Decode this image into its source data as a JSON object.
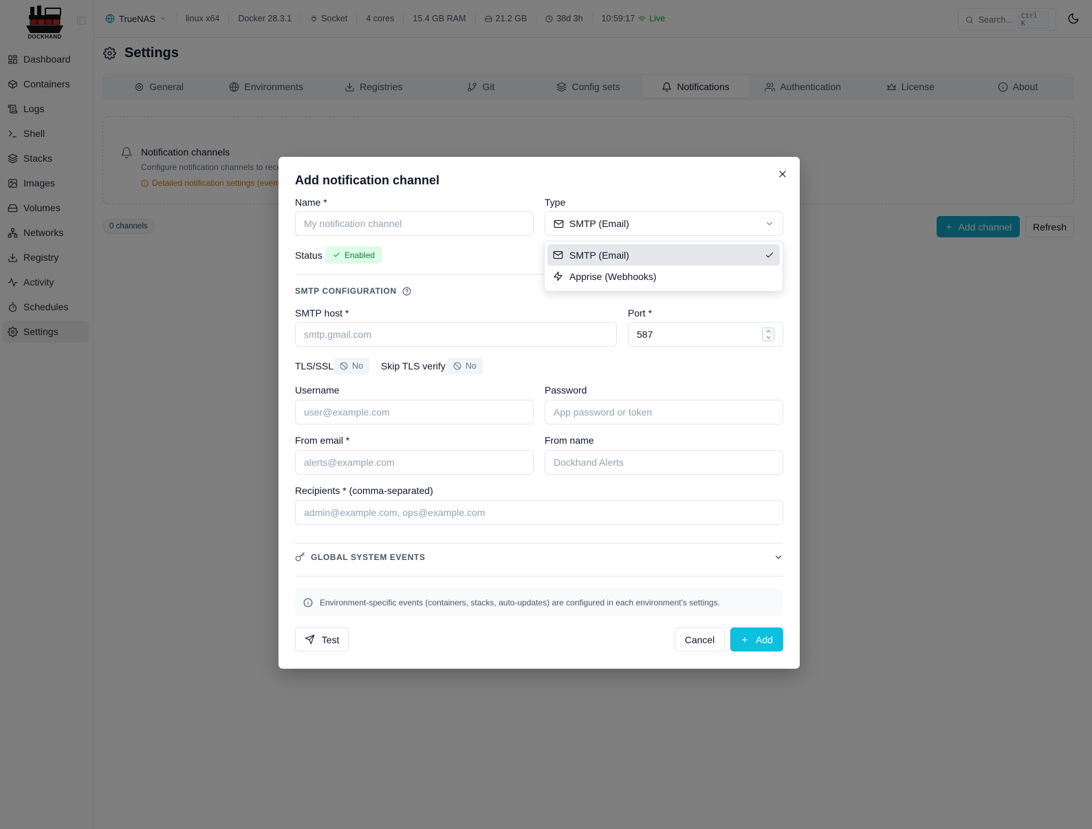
{
  "app": {
    "logo_text": "DOCKHAND"
  },
  "sidebar": {
    "items": [
      {
        "label": "Dashboard",
        "icon": "dashboard-icon"
      },
      {
        "label": "Containers",
        "icon": "box-icon"
      },
      {
        "label": "Logs",
        "icon": "scroll-icon"
      },
      {
        "label": "Shell",
        "icon": "terminal-icon"
      },
      {
        "label": "Stacks",
        "icon": "layers-icon"
      },
      {
        "label": "Images",
        "icon": "images-icon"
      },
      {
        "label": "Volumes",
        "icon": "hard-drive-icon"
      },
      {
        "label": "Networks",
        "icon": "network-icon"
      },
      {
        "label": "Registry",
        "icon": "download-icon"
      },
      {
        "label": "Activity",
        "icon": "activity-icon"
      },
      {
        "label": "Schedules",
        "icon": "timer-icon"
      },
      {
        "label": "Settings",
        "icon": "gear-icon"
      }
    ],
    "active": "Settings"
  },
  "header": {
    "environment": "TrueNAS",
    "platform": "linux x64",
    "docker": "Docker 28.3.1",
    "connection": "Socket",
    "cores": "4 cores",
    "ram": "15.4 GB RAM",
    "disk": "21.2 GB",
    "uptime": "38d 3h",
    "time": "10:59:17",
    "status": "Live",
    "search_placeholder": "Search...",
    "search_shortcut": "Ctrl K"
  },
  "page": {
    "title": "Settings",
    "tabs": [
      {
        "label": "General",
        "icon": "gear-icon"
      },
      {
        "label": "Environments",
        "icon": "globe-icon"
      },
      {
        "label": "Registries",
        "icon": "download-icon"
      },
      {
        "label": "Git",
        "icon": "git-branch-icon"
      },
      {
        "label": "Config sets",
        "icon": "layers-icon"
      },
      {
        "label": "Notifications",
        "icon": "bell-icon"
      },
      {
        "label": "Authentication",
        "icon": "users-icon"
      },
      {
        "label": "License",
        "icon": "crown-icon"
      },
      {
        "label": "About",
        "icon": "info-icon"
      }
    ],
    "active_tab": "Notifications",
    "channels_card": {
      "title": "Notification channels",
      "description": "Configure notification channels to rece",
      "warning": "Detailed notification settings (event"
    },
    "channel_count": "0 channels",
    "add_channel_label": "Add channel",
    "refresh_label": "Refresh"
  },
  "modal": {
    "title": "Add notification channel",
    "name_label": "Name *",
    "name_placeholder": "My notification channel",
    "type_label": "Type",
    "type_value": "SMTP (Email)",
    "status_label": "Status",
    "status_value": "Enabled",
    "section_title": "SMTP CONFIGURATION",
    "smtp_host_label": "SMTP host *",
    "smtp_host_placeholder": "smtp.gmail.com",
    "port_label": "Port *",
    "port_value": "587",
    "tls_label": "TLS/SSL",
    "tls_value": "No",
    "skip_tls_label": "Skip TLS verify",
    "skip_tls_value": "No",
    "username_label": "Username",
    "username_placeholder": "user@example.com",
    "password_label": "Password",
    "password_placeholder": "App password or token",
    "from_email_label": "From email *",
    "from_email_placeholder": "alerts@example.com",
    "from_name_label": "From name",
    "from_name_placeholder": "Dockhand Alerts",
    "recipients_label": "Recipients * (comma-separated)",
    "recipients_placeholder": "admin@example.com, ops@example.com",
    "global_events_label": "GLOBAL SYSTEM EVENTS",
    "info_text": "Environment-specific events (containers, stacks, auto-updates) are configured in each environment's settings.",
    "test_label": "Test",
    "cancel_label": "Cancel",
    "add_label": "Add"
  },
  "dropdown": {
    "options": [
      {
        "label": "SMTP (Email)",
        "icon": "mail-icon",
        "selected": true
      },
      {
        "label": "Apprise (Webhooks)",
        "icon": "zap-icon",
        "selected": false
      }
    ]
  },
  "colors": {
    "accent": "#0ec0e0",
    "accent_dark": "#0ea5c6",
    "success": "#16a34a",
    "warning": "#d97706",
    "overlay": "rgba(0,0,0,0.5)"
  }
}
